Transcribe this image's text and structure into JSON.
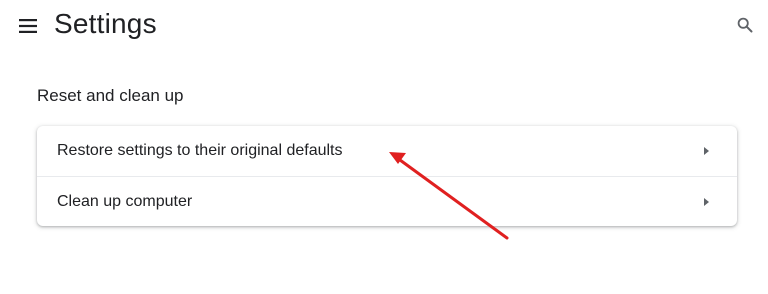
{
  "header": {
    "title": "Settings",
    "menu_icon": "hamburger-menu-icon",
    "search_icon": "search-icon"
  },
  "section": {
    "title": "Reset and clean up",
    "items": [
      {
        "label": "Restore settings to their original defaults",
        "icon": "chevron-right-icon"
      },
      {
        "label": "Clean up computer",
        "icon": "chevron-right-icon"
      }
    ]
  },
  "colors": {
    "text": "#202124",
    "annotation_arrow": "#e02020",
    "divider": "#e8eaed"
  }
}
